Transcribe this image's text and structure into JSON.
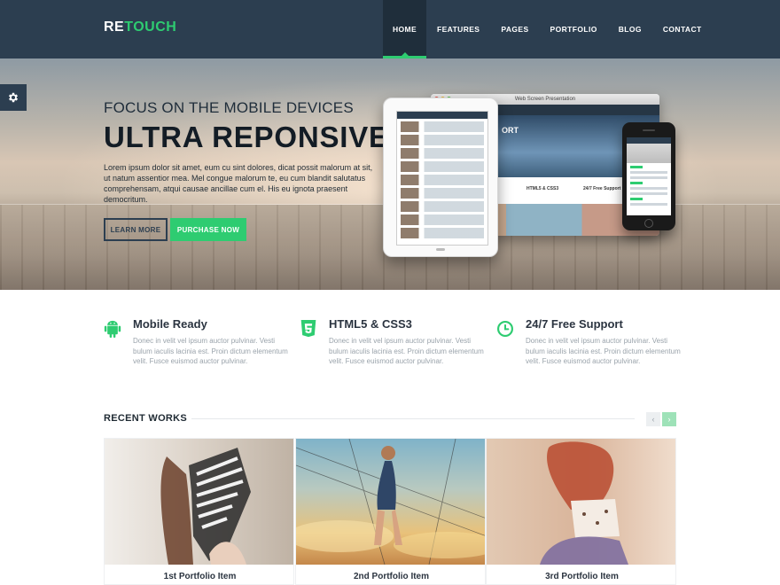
{
  "nav": {
    "logo_part1": "RE",
    "logo_part2": "TOUCH",
    "items": [
      {
        "label": "HOME",
        "active": true
      },
      {
        "label": "FEATURES",
        "active": false
      },
      {
        "label": "PAGES",
        "active": false
      },
      {
        "label": "PORTFOLIO",
        "active": false
      },
      {
        "label": "BLOG",
        "active": false
      },
      {
        "label": "CONTACT",
        "active": false
      }
    ]
  },
  "settings": {
    "icon": "gear-icon"
  },
  "hero": {
    "subtitle": "FOCUS ON THE MOBILE DEVICES",
    "title": "ULTRA REPONSIVE",
    "text": "Lorem ipsum dolor sit amet, eum cu sint dolores, dicat possit malorum at sit, ut natum assentior mea. Mel congue malorum te, eu cum blandit salutatus comprehensam, atqui causae ancillae cum el. His eu ignota praesent democritum.",
    "learn_more": "LEARN MORE",
    "purchase": "PURCHASE NOW",
    "monitor_title": "Web Screen Presentation",
    "monitor_hero_text": "ORT",
    "monitor_feat1": "HTML5 & CSS3",
    "monitor_feat2": "24/7 Free Support"
  },
  "features": [
    {
      "icon": "android-icon",
      "title": "Mobile Ready",
      "text": "Donec in velit vel ipsum auctor pulvinar. Vesti bulum iaculis lacinia est. Proin dictum elementum velit. Fusce euismod auctor pulvinar."
    },
    {
      "icon": "html5-icon",
      "title": "HTML5 & CSS3",
      "text": "Donec in velit vel ipsum auctor pulvinar. Vesti bulum iaculis lacinia est. Proin dictum elementum velit. Fusce euismod auctor pulvinar."
    },
    {
      "icon": "clock-icon",
      "title": "24/7 Free Support",
      "text": "Donec in velit vel ipsum auctor pulvinar. Vesti bulum iaculis lacinia est. Proin dictum elementum velit. Fusce euismod auctor pulvinar."
    }
  ],
  "recent_works": {
    "title": "RECENT WORKS",
    "prev": "‹",
    "next": "›",
    "items": [
      {
        "caption": "1st Portfolio Item"
      },
      {
        "caption": "2nd Portfolio Item"
      },
      {
        "caption": "3rd Portfolio Item"
      }
    ]
  },
  "colors": {
    "nav_bg": "#2c3e50",
    "accent": "#2ecc71",
    "text_dark": "#2b3440",
    "text_muted": "#9aa3ab"
  }
}
